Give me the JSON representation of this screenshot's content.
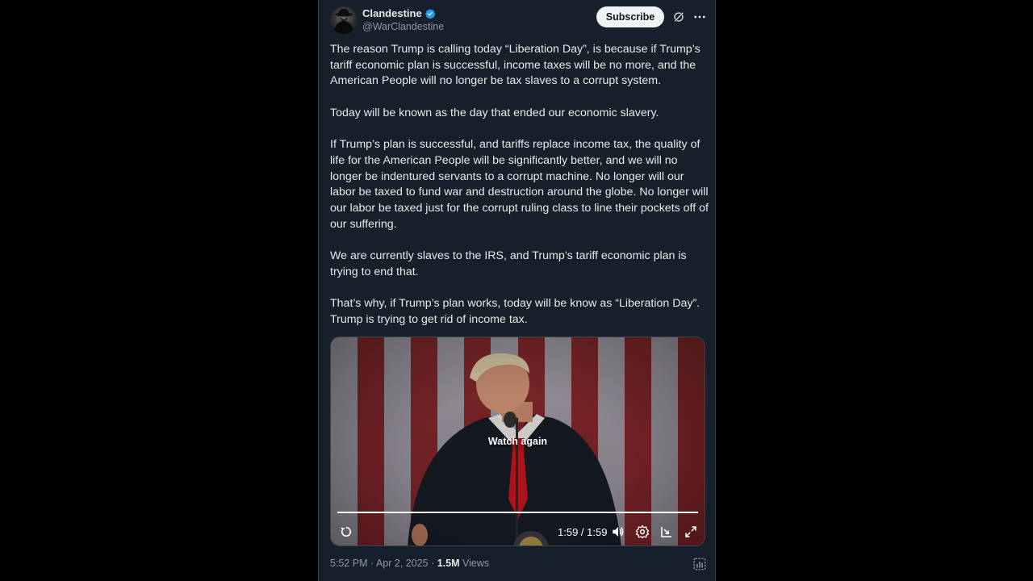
{
  "author": {
    "name": "Clandestine",
    "handle": "@WarClandestine",
    "verified": true
  },
  "actions": {
    "subscribe_label": "Subscribe",
    "grok_icon": "grok-icon",
    "more_icon": "more-icon"
  },
  "tweet": {
    "paragraphs": [
      "The reason Trump is calling today “Liberation Day”, is because if Trump’s tariff economic plan is successful, income taxes will be no more, and the American People will no longer be tax slaves to a corrupt system.",
      "Today will be known as the day that ended our economic slavery.",
      "If Trump’s plan is successful, and tariffs replace income tax, the quality of life for the American People will be significantly better, and we will no longer be indentured servants to a corrupt machine. No longer will our labor be taxed to fund war and destruction around the globe. No longer will our labor be taxed just for the corrupt ruling class to line their pockets off of our suffering.",
      "We are currently slaves to the IRS, and Trump’s tariff economic plan is trying to end that.",
      "That’s why, if Trump’s plan works, today will be know as “Liberation Day”. Trump is trying to get rid of income tax."
    ]
  },
  "video": {
    "overlay_label": "Watch again",
    "progress_fraction": 1.0,
    "time_display": "1:59 / 1:59",
    "controls": [
      "replay-icon",
      "volume-icon",
      "settings-icon",
      "pip-icon",
      "fullscreen-icon"
    ]
  },
  "footer": {
    "timestamp": "5:52 PM · Apr 2, 2025",
    "separator": " · ",
    "views_count": "1.5M",
    "views_label": " Views"
  },
  "colors": {
    "background": "#15202b",
    "text": "#e7e9ea",
    "muted": "#8b98a5",
    "verified": "#1d9bf0"
  }
}
